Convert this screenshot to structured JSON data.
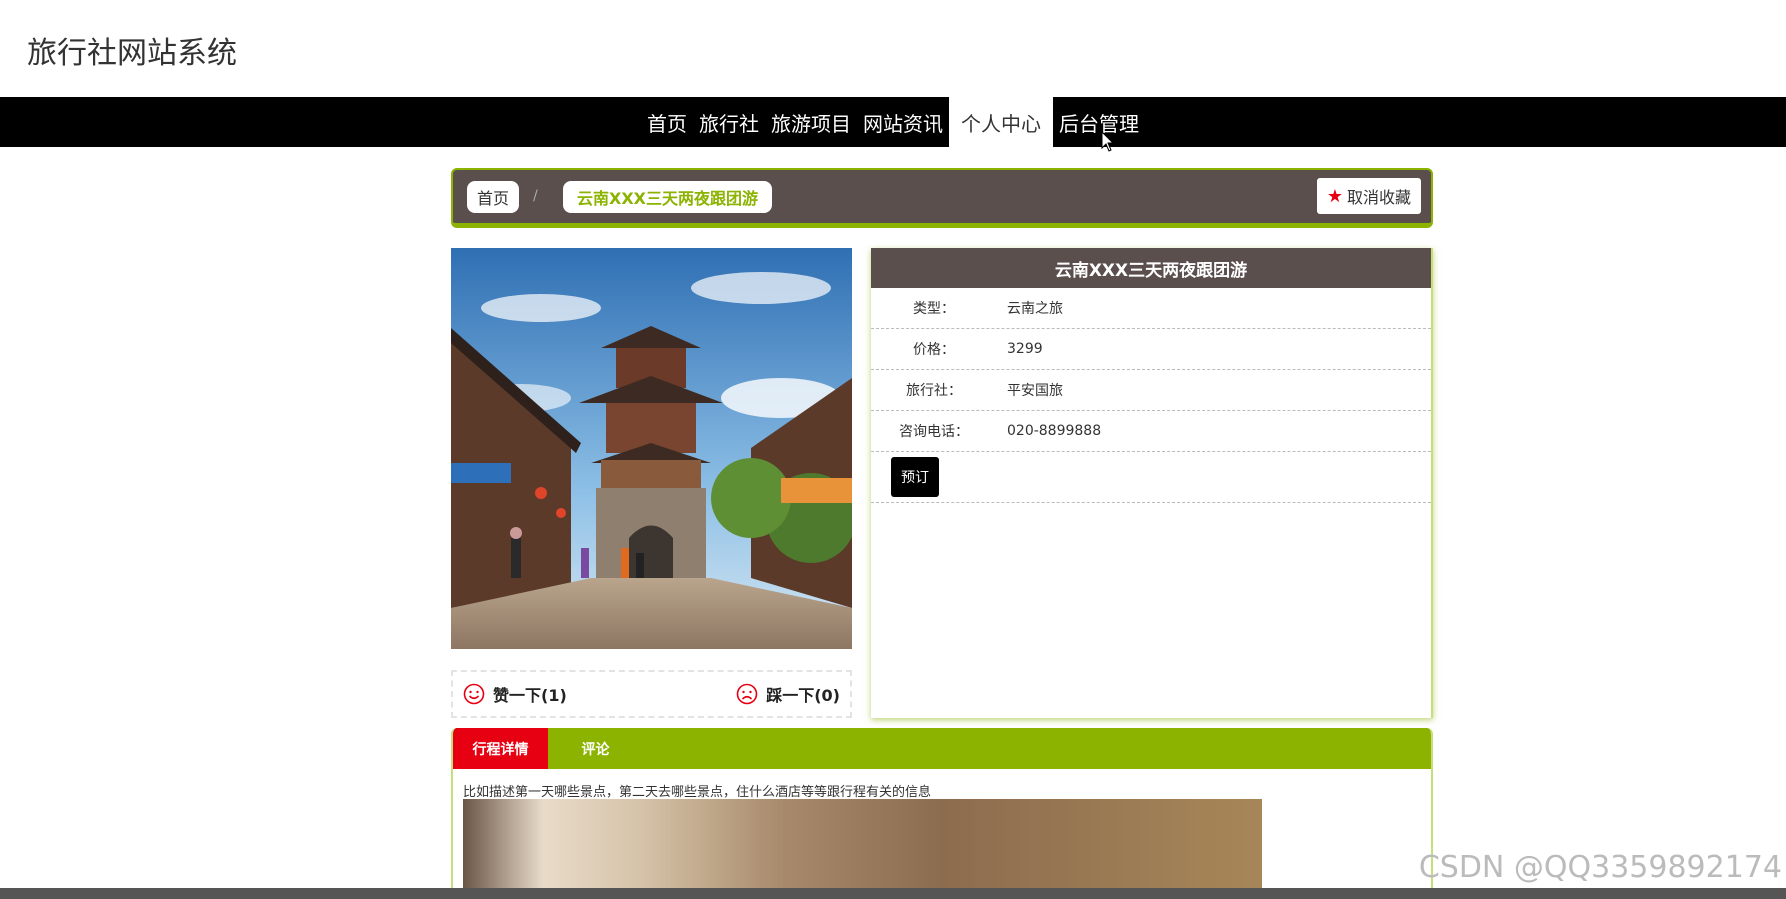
{
  "header": {
    "site_title": "旅行社网站系统"
  },
  "nav": {
    "items": [
      {
        "label": "首页",
        "active": false
      },
      {
        "label": "旅行社",
        "active": false
      },
      {
        "label": "旅游项目",
        "active": false
      },
      {
        "label": "网站资讯",
        "active": false
      },
      {
        "label": "个人中心",
        "active": true
      },
      {
        "label": "后台管理",
        "active": false
      }
    ]
  },
  "breadcrumb": {
    "home": "首页",
    "separator": "/",
    "current": "云南XXX三天两夜跟团游"
  },
  "favorite": {
    "label": "取消收藏",
    "icon": "star-icon"
  },
  "votes": {
    "like_label": "赞一下(1)",
    "dislike_label": "踩一下(0)"
  },
  "detail": {
    "title": "云南XXX三天两夜跟团游",
    "fields": [
      {
        "label": "类型：",
        "value": "云南之旅"
      },
      {
        "label": "价格：",
        "value": "3299"
      },
      {
        "label": "旅行社：",
        "value": "平安国旅"
      },
      {
        "label": "咨询电话：",
        "value": "020-8899888"
      }
    ],
    "book_label": "预订"
  },
  "tabs": {
    "items": [
      {
        "label": "行程详情",
        "active": true
      },
      {
        "label": "评论",
        "active": false
      }
    ],
    "content_text": "比如描述第一天哪些景点，第二天去哪些景点，住什么酒店等等跟行程有关的信息"
  },
  "watermark": "CSDN @QQ3359892174",
  "colors": {
    "accent_green": "#8bb300",
    "header_brown": "#5a4f4d",
    "active_red": "#e60012",
    "nav_black": "#000000"
  }
}
